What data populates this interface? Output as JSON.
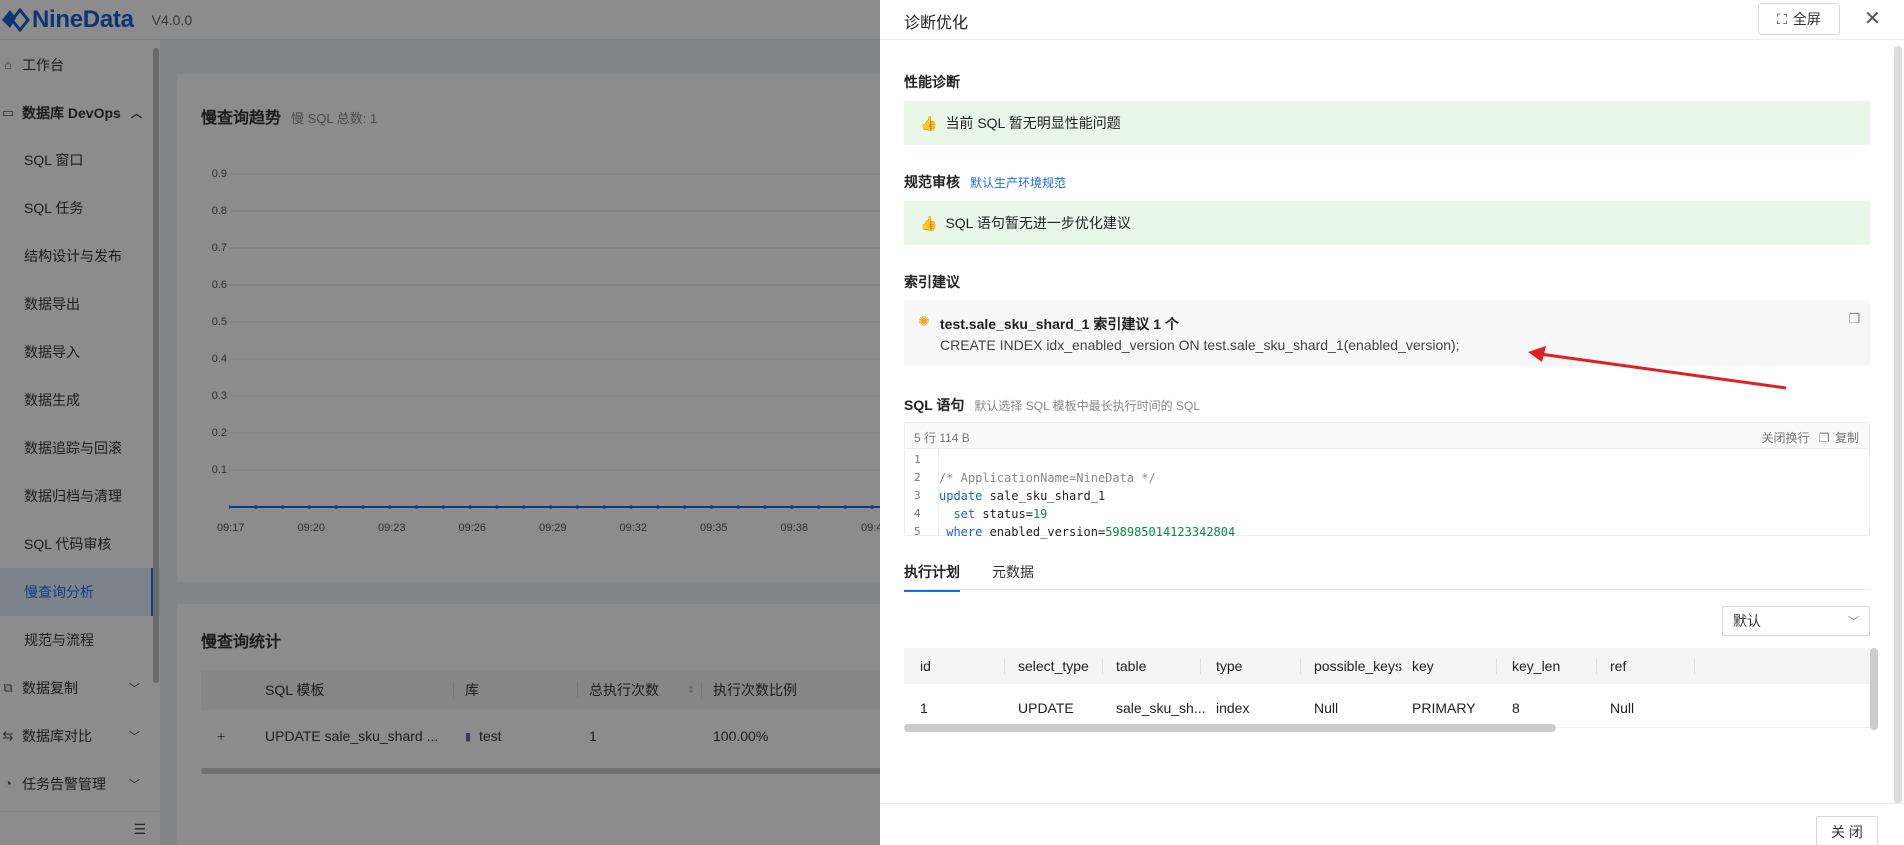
{
  "header": {
    "brand": "NineData",
    "version": "V4.0.0"
  },
  "sidebar": {
    "items": [
      {
        "label": "工作台",
        "icon": "home-icon"
      },
      {
        "label": "数据库 DevOps",
        "icon": "monitor-icon"
      },
      {
        "label": "SQL 窗口"
      },
      {
        "label": "SQL 任务"
      },
      {
        "label": "结构设计与发布"
      },
      {
        "label": "数据导出"
      },
      {
        "label": "数据导入"
      },
      {
        "label": "数据生成"
      },
      {
        "label": "数据追踪与回滚"
      },
      {
        "label": "数据归档与清理"
      },
      {
        "label": "SQL 代码审核"
      },
      {
        "label": "慢查询分析"
      },
      {
        "label": "规范与流程"
      },
      {
        "label": "数据复制",
        "icon": "copy-icon"
      },
      {
        "label": "数据库对比",
        "icon": "compare-icon"
      },
      {
        "label": "任务告警管理",
        "icon": "bell-icon"
      }
    ],
    "active": "慢查询分析"
  },
  "trend": {
    "title": "慢查询趋势",
    "count_label": "慢 SQL 总数: 1",
    "y_ticks": [
      "0.9",
      "0.8",
      "0.7",
      "0.6",
      "0.5",
      "0.4",
      "0.3",
      "0.2",
      "0.1"
    ],
    "x_ticks": [
      "09:17",
      "09:20",
      "09:23",
      "09:26",
      "09:29",
      "09:32",
      "09:35",
      "09:38",
      "09:4"
    ]
  },
  "stats": {
    "title": "慢查询统计",
    "columns": [
      "SQL 模板",
      "库",
      "总执行次数",
      "执行次数比例"
    ],
    "row": {
      "sql": "UPDATE sale_sku_shard ...",
      "db": "test",
      "total": "1",
      "ratio": "100.00%"
    }
  },
  "drawer": {
    "title": "诊断优化",
    "fullscreen_label": "全屏",
    "perf": {
      "title": "性能诊断",
      "message": "当前 SQL 暂无明显性能问题"
    },
    "review": {
      "title": "规范审核",
      "link": "默认生产环境规范",
      "message": "SQL 语句暂无进一步优化建议"
    },
    "index": {
      "title": "索引建议",
      "headline": "test.sale_sku_shard_1 索引建议 1 个",
      "sql": "CREATE INDEX idx_enabled_version ON test.sale_sku_shard_1(enabled_version);"
    },
    "sql_section": {
      "title": "SQL 语句",
      "note": "默认选择 SQL 模板中最长执行时间的 SQL",
      "meta": "5 行   114 B",
      "wrap_label": "关闭换行",
      "copy_label": "复制",
      "lines": [
        {
          "n": "1",
          "comment": "",
          "kw": "",
          "text": ""
        },
        {
          "n": "2",
          "comment": "/* ApplicationName=NineData */",
          "kw": "",
          "text": ""
        },
        {
          "n": "3",
          "comment": "",
          "kw": "update",
          "text": " sale_sku_shard_1"
        },
        {
          "n": "4",
          "comment": "",
          "kw": "set",
          "text": " status=",
          "num": "19"
        },
        {
          "n": "5",
          "comment": "",
          "kw": "where",
          "text": " enabled_version=",
          "num": "598985014123342804"
        }
      ]
    },
    "tabs": [
      "执行计划",
      "元数据"
    ],
    "plan": {
      "select_value": "默认",
      "columns": [
        "id",
        "select_type",
        "table",
        "type",
        "possible_keys",
        "key",
        "key_len",
        "ref"
      ],
      "row": [
        "1",
        "UPDATE",
        "sale_sku_sh...",
        "index",
        "Null",
        "PRIMARY",
        "8",
        "Null"
      ]
    },
    "close_label": "关 闭"
  },
  "colors": {
    "accent": "#1a6cf0",
    "success_bg": "#e8f7e8",
    "annotation_arrow": "#e02020"
  }
}
